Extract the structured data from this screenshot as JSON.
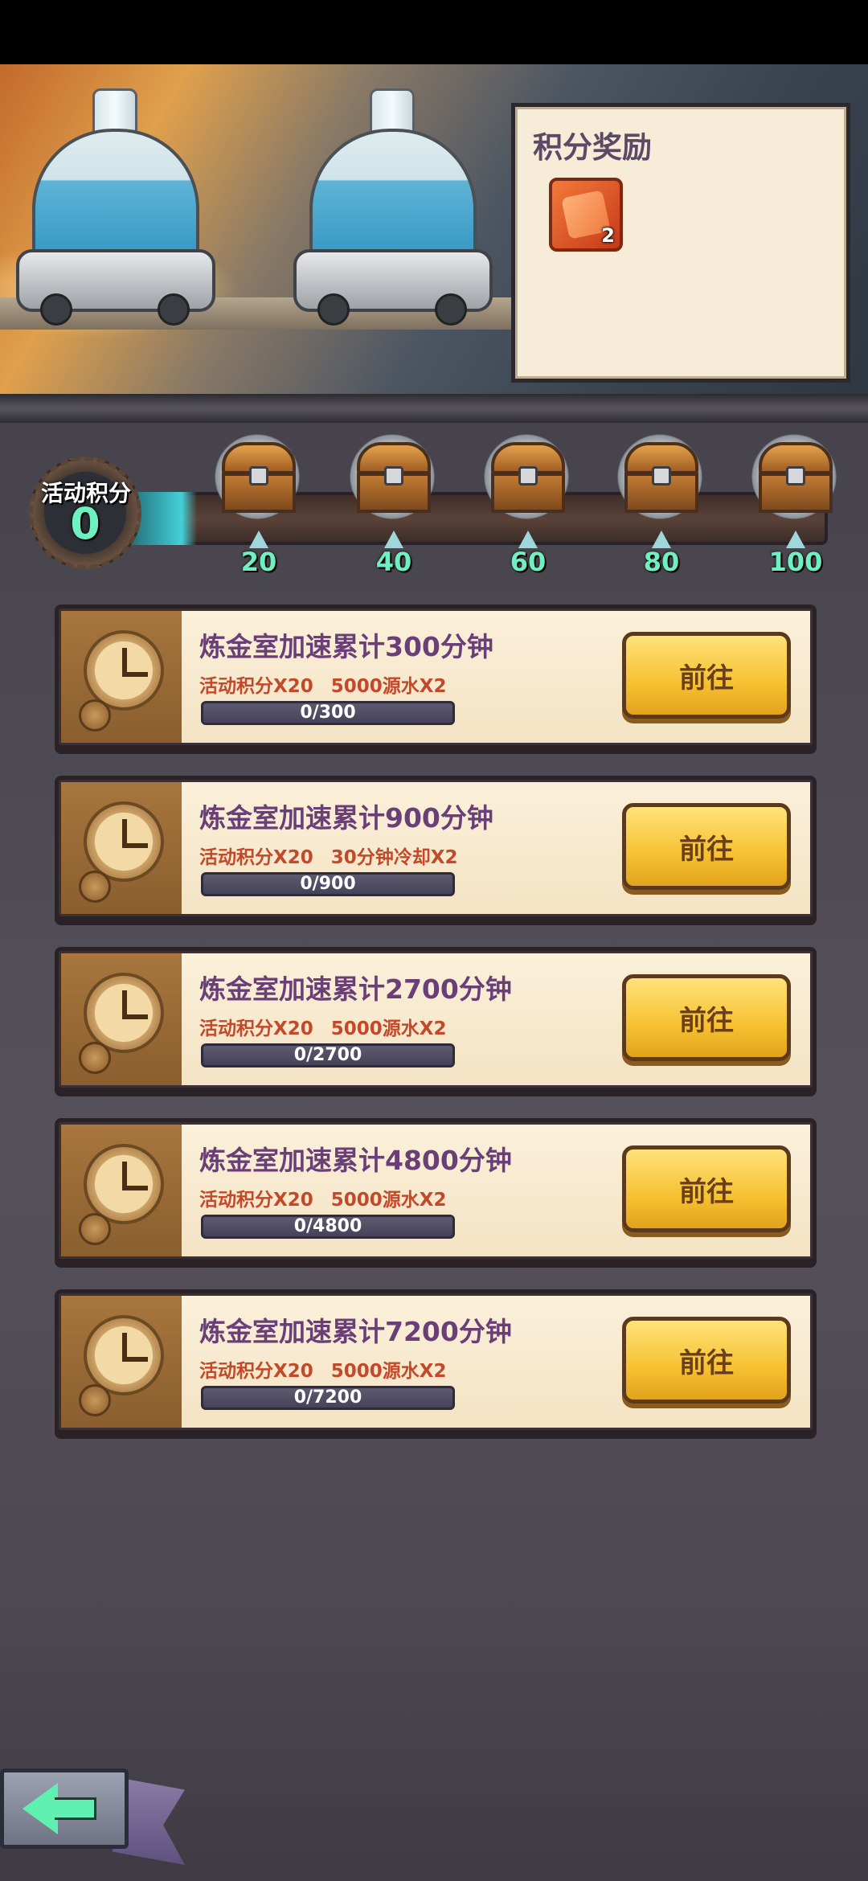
{
  "reward_panel": {
    "title": "积分奖励",
    "item": {
      "icon": "puzzle-piece-icon",
      "count": "2"
    }
  },
  "activity": {
    "label": "活动积分",
    "value": "0",
    "progress": 0,
    "milestones": [
      "20",
      "40",
      "60",
      "80",
      "100"
    ]
  },
  "tasks": [
    {
      "title": "炼金室加速累计300分钟",
      "rewards": [
        "活动积分X20",
        "5000源水X2"
      ],
      "progress": "0/300",
      "fraction": 0,
      "button": "前往"
    },
    {
      "title": "炼金室加速累计900分钟",
      "rewards": [
        "活动积分X20",
        "30分钟冷却X2"
      ],
      "progress": "0/900",
      "fraction": 0,
      "button": "前往"
    },
    {
      "title": "炼金室加速累计2700分钟",
      "rewards": [
        "活动积分X20",
        "5000源水X2"
      ],
      "progress": "0/2700",
      "fraction": 0,
      "button": "前往"
    },
    {
      "title": "炼金室加速累计4800分钟",
      "rewards": [
        "活动积分X20",
        "5000源水X2"
      ],
      "progress": "0/4800",
      "fraction": 0,
      "button": "前往"
    },
    {
      "title": "炼金室加速累计7200分钟",
      "rewards": [
        "活动积分X20",
        "5000源水X2"
      ],
      "progress": "0/7200",
      "fraction": 0,
      "button": "前往"
    }
  ],
  "back_icon": "back-arrow-icon",
  "colors": {
    "accent_green": "#6ef0c2",
    "title_purple": "#6a3f78",
    "reward_red": "#c24a2a",
    "button_yellow": "#f6c132"
  }
}
